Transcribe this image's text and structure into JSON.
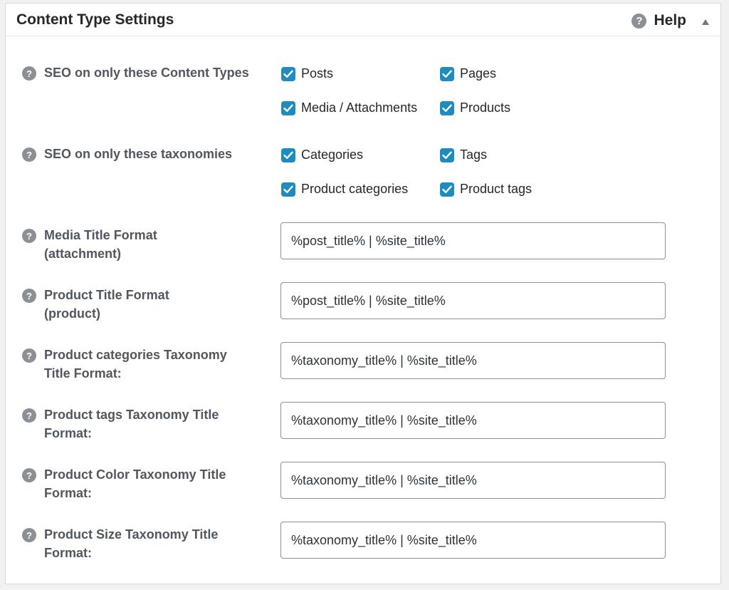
{
  "panel": {
    "title": "Content Type Settings",
    "help_label": "Help"
  },
  "content_types": {
    "label": "SEO on only these Content Types",
    "options": [
      {
        "label": "Posts",
        "checked": true
      },
      {
        "label": "Pages",
        "checked": true
      },
      {
        "label": "Media / Attachments",
        "checked": true
      },
      {
        "label": "Products",
        "checked": true
      }
    ]
  },
  "taxonomies": {
    "label": "SEO on only these taxonomies",
    "options": [
      {
        "label": "Categories",
        "checked": true
      },
      {
        "label": "Tags",
        "checked": true
      },
      {
        "label": "Product categories",
        "checked": true
      },
      {
        "label": "Product tags",
        "checked": true
      }
    ]
  },
  "title_formats": [
    {
      "label_line1": "Media Title Format",
      "label_line2": "(attachment)",
      "value": "%post_title% | %site_title%"
    },
    {
      "label_line1": "Product Title Format",
      "label_line2": "(product)",
      "value": "%post_title% | %site_title%"
    },
    {
      "label_line1": "Product categories Taxonomy",
      "label_line2": "Title Format:",
      "value": "%taxonomy_title% | %site_title%"
    },
    {
      "label_line1": "Product tags Taxonomy Title",
      "label_line2": "Format:",
      "value": "%taxonomy_title% | %site_title%"
    },
    {
      "label_line1": "Product Color Taxonomy Title",
      "label_line2": "Format:",
      "value": "%taxonomy_title% | %site_title%"
    },
    {
      "label_line1": "Product Size Taxonomy Title",
      "label_line2": "Format:",
      "value": "%taxonomy_title% | %site_title%"
    }
  ],
  "icons": {
    "help": "question-circle-icon",
    "toggle": "triangle-up-icon",
    "checkbox": "checkmark-icon"
  },
  "colors": {
    "checkbox_fill": "#1e8cbe",
    "help_icon": "#8c8f94"
  }
}
